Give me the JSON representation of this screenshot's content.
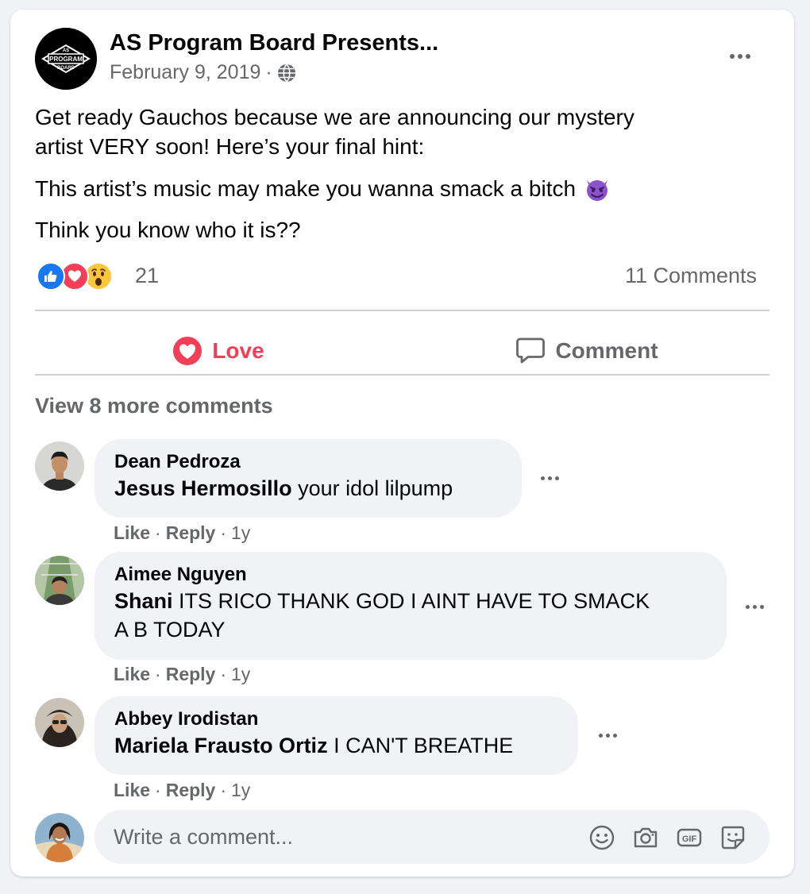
{
  "post": {
    "page_name": "AS Program Board Presents...",
    "date": "February 9, 2019",
    "separator": "·",
    "avatar_logo": "AS PROGRAM BOARD",
    "lines": [
      "Get ready Gauchos because we are announcing our mystery",
      "artist VERY soon! Here’s your final hint:",
      "This artist’s music may make you wanna smack a bitch",
      "Think you know who it is??"
    ],
    "emoji_icon": "smiling-devil-icon"
  },
  "stats": {
    "reaction_count": "21",
    "comment_count": "11 Comments",
    "reaction_icons": [
      "like-reaction-icon",
      "love-reaction-icon",
      "wow-reaction-icon"
    ]
  },
  "actions": {
    "love_label": "Love",
    "comment_label": "Comment"
  },
  "view_more": "View 8 more comments",
  "comments": [
    {
      "author": "Dean Pedroza",
      "mention": "Jesus Hermosillo",
      "text": " your idol lilpump",
      "like": "Like",
      "reply": "Reply",
      "time": "1y"
    },
    {
      "author": "Aimee Nguyen",
      "mention": "Shani",
      "text": " ITS RICO THANK GOD I AINT HAVE TO SMACK",
      "text2": "A B TODAY",
      "like": "Like",
      "reply": "Reply",
      "time": "1y"
    },
    {
      "author": "Abbey Irodistan",
      "mention": "Mariela Frausto Ortiz",
      "text": " I CAN'T BREATHE",
      "like": "Like",
      "reply": "Reply",
      "time": "1y"
    }
  ],
  "composer": {
    "placeholder": "Write a comment...",
    "icons": [
      "emoji-icon",
      "camera-icon",
      "gif-icon",
      "sticker-icon"
    ]
  },
  "colors": {
    "love": "#f33e58",
    "like": "#1877f2",
    "muted": "#65676b",
    "bubble": "#f0f2f5"
  }
}
